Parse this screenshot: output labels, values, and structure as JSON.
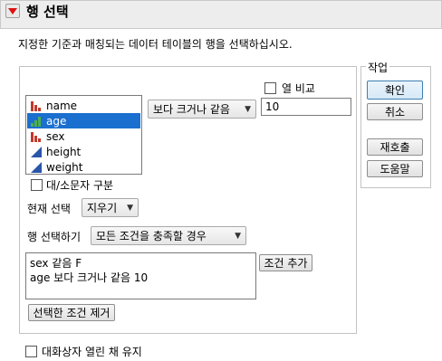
{
  "title": "행 선택",
  "instruction": "지정한 기준과 매칭되는 데이터 테이블의 행을 선택하십시오.",
  "columns": [
    {
      "name": "name",
      "icon": "nominal-bar-icon",
      "selected": false
    },
    {
      "name": "age",
      "icon": "ordinal-bar-icon",
      "selected": true
    },
    {
      "name": "sex",
      "icon": "nominal-bar-icon",
      "selected": false
    },
    {
      "name": "height",
      "icon": "continuous-triangle-icon",
      "selected": false
    },
    {
      "name": "weight",
      "icon": "continuous-triangle-icon",
      "selected": false
    }
  ],
  "operator": {
    "value": "보다 크거나 같음"
  },
  "compare_columns": {
    "label": "열 비교",
    "checked": false
  },
  "value_input": {
    "value": "10"
  },
  "case_sensitive": {
    "label": "대/소문자 구분",
    "checked": false
  },
  "current_selection": {
    "label": "현재 선택",
    "value": "지우기"
  },
  "select_rows": {
    "label": "행 선택하기",
    "value": "모든 조건을 충족할 경우"
  },
  "add_condition_label": "조건 추가",
  "criteria": [
    "sex 같음 F",
    "age 보다 크거나 같음 10"
  ],
  "remove_selected_label": "선택한 조건 제거",
  "action": {
    "legend": "작업",
    "ok_label": "확인",
    "cancel_label": "취소",
    "recall_label": "재호출",
    "help_label": "도움말"
  },
  "keep_dialog_open": {
    "label": "대화상자 열린 채 유지",
    "checked": false
  },
  "colors": {
    "selection": "#1a6fcf",
    "nominal": "#c0392b",
    "ordinal": "#4caf50",
    "continuous": "#2a55a8",
    "collapse_arrow": "#dd1111"
  }
}
